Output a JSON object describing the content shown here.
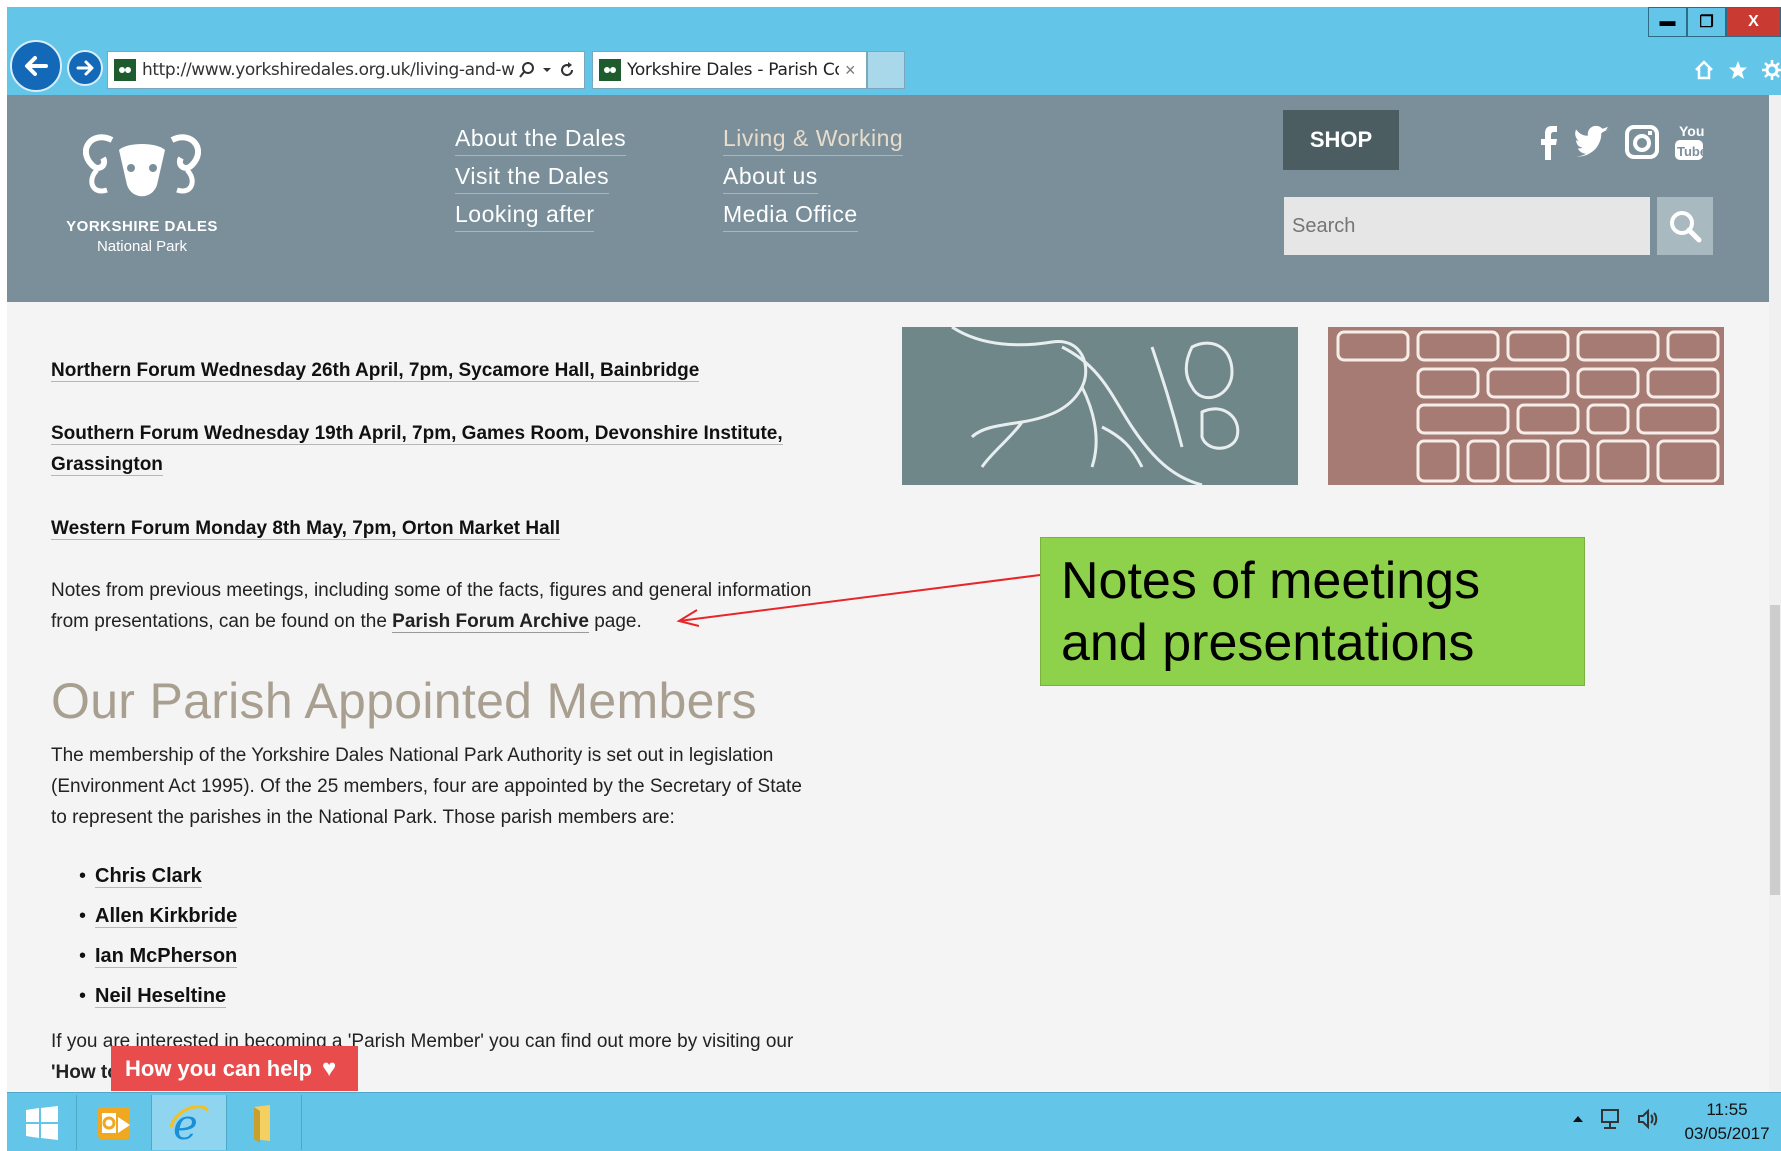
{
  "browser": {
    "url": "http://www.yorkshiredales.org.uk/living-and-wo",
    "tab_title": "Yorkshire Dales - Parish Co...",
    "tab_close": "×",
    "window_buttons": {
      "minimize": "▬",
      "restore": "❐",
      "close": "X"
    }
  },
  "site": {
    "logo_line1": "YORKSHIRE DALES",
    "logo_line2": "National Park",
    "nav": {
      "about_dales": "About the Dales",
      "visit": "Visit the Dales",
      "looking_after": "Looking after",
      "living_working": "Living & Working",
      "about_us": "About us",
      "media_office": "Media Office"
    },
    "shop_label": "SHOP",
    "search_placeholder": "Search",
    "social_icons": [
      "facebook-icon",
      "twitter-icon",
      "instagram-icon",
      "youtube-icon"
    ]
  },
  "content": {
    "forum_northern": "Northern Forum Wednesday 26th April, 7pm, Sycamore Hall, Bainbridge",
    "forum_southern_1": "Southern Forum Wednesday 19th April, 7pm, Games Room, Devonshire Institute,",
    "forum_southern_2": "Grassington",
    "forum_western": "Western Forum Monday 8th May, 7pm, Orton Market Hall",
    "notes_line1": "Notes from previous meetings, including some of the facts, figures and general information",
    "notes_line2_pre": "from presentations, can be found on the ",
    "notes_link": "Parish Forum Archive",
    "notes_line2_post": " page.",
    "heading": "Our Parish Appointed Members",
    "membership_line1": "The membership of the Yorkshire Dales National Park Authority is set out in legislation",
    "membership_line2": "(Environment Act 1995). Of the 25 members, four are appointed by the Secretary of State",
    "membership_line3": "to represent the parishes in the National Park. Those parish members are:",
    "members": [
      "Chris Clark",
      "Allen Kirkbride",
      "Ian McPherson",
      "Neil Heseltine"
    ],
    "bullet": "•",
    "interested_line1": "If you are interested in becoming a 'Parish Member' you can find out more by visiting our",
    "interested_line2": "'How to",
    "help_tab": "How you can help",
    "help_icon": "♥"
  },
  "annotation": {
    "line1": "Notes of meetings",
    "line2": "and presentations",
    "color": "#8ed14b"
  },
  "taskbar": {
    "time": "11:55",
    "date": "03/05/2017"
  }
}
